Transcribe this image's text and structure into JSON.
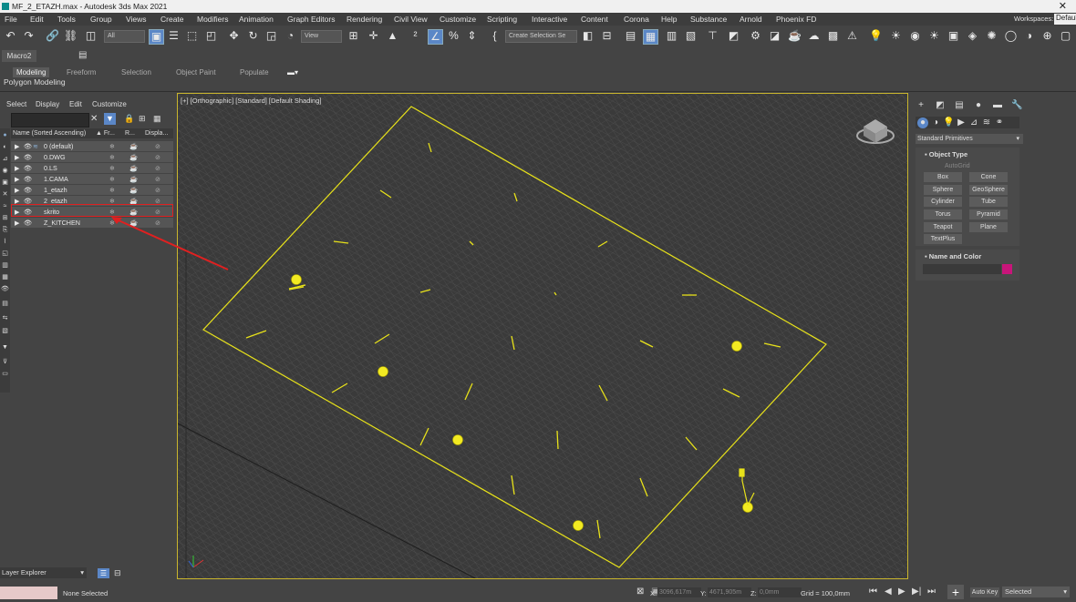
{
  "window": {
    "title": "MF_2_ETAZH.max - Autodesk 3ds Max 2021",
    "close": "✕"
  },
  "menu": [
    "File",
    "Edit",
    "Tools",
    "Group",
    "Views",
    "Create",
    "Modifiers",
    "Animation",
    "Graph Editors",
    "Rendering",
    "Civil View",
    "Customize",
    "Scripting",
    "Interactive",
    "Content",
    "Corona",
    "Help",
    "Substance",
    "Arnold",
    "Phoenix FD"
  ],
  "workspaces": {
    "label": "Workspaces:",
    "value": "Default"
  },
  "toolbar": {
    "filter": "All",
    "refcoord": "View",
    "selection_set": "Create Selection Se"
  },
  "macro": {
    "tab": "Macro2"
  },
  "ribbon": {
    "tabs": [
      "Modeling",
      "Freeform",
      "Selection",
      "Object Paint",
      "Populate"
    ],
    "active": "Modeling",
    "subtitle": "Polygon Modeling"
  },
  "scene_explorer": {
    "menu": [
      "Select",
      "Display",
      "Edit",
      "Customize"
    ],
    "columns": [
      "Name (Sorted Ascending)",
      "▲ Fr...",
      "R...",
      "Displa..."
    ],
    "layers": [
      "0 (default)",
      "0.DWG",
      "0.LS",
      "1.CAMA",
      "1_etazh",
      "2_etazh",
      "skrito",
      "Z_KITCHEN"
    ],
    "footer": "Layer Explorer"
  },
  "viewport": {
    "label": "[+] [Orthographic] [Standard] [Default Shading]"
  },
  "command_panel": {
    "category": "Standard Primitives",
    "object_type": "Object Type",
    "autogrid": "AutoGrid",
    "primitives": [
      "Box",
      "Cone",
      "Sphere",
      "GeoSphere",
      "Cylinder",
      "Tube",
      "Torus",
      "Pyramid",
      "Teapot",
      "Plane",
      "TextPlus"
    ],
    "name_color": "Name and Color",
    "swatch_color": "#c8157a"
  },
  "status": {
    "selection": "None Selected",
    "x_label": "X:",
    "x_value": "3096,617m",
    "y_label": "Y:",
    "y_value": "4671,905m",
    "z_label": "Z:",
    "z_value": "0,0mm",
    "grid": "Grid = 100,0mm",
    "autokey": "Auto Key",
    "selected": "Selected"
  },
  "colors": {
    "highlight_box": "#e02020",
    "viewport_border": "#c9b52d",
    "object_yellow": "#e8e21a"
  }
}
